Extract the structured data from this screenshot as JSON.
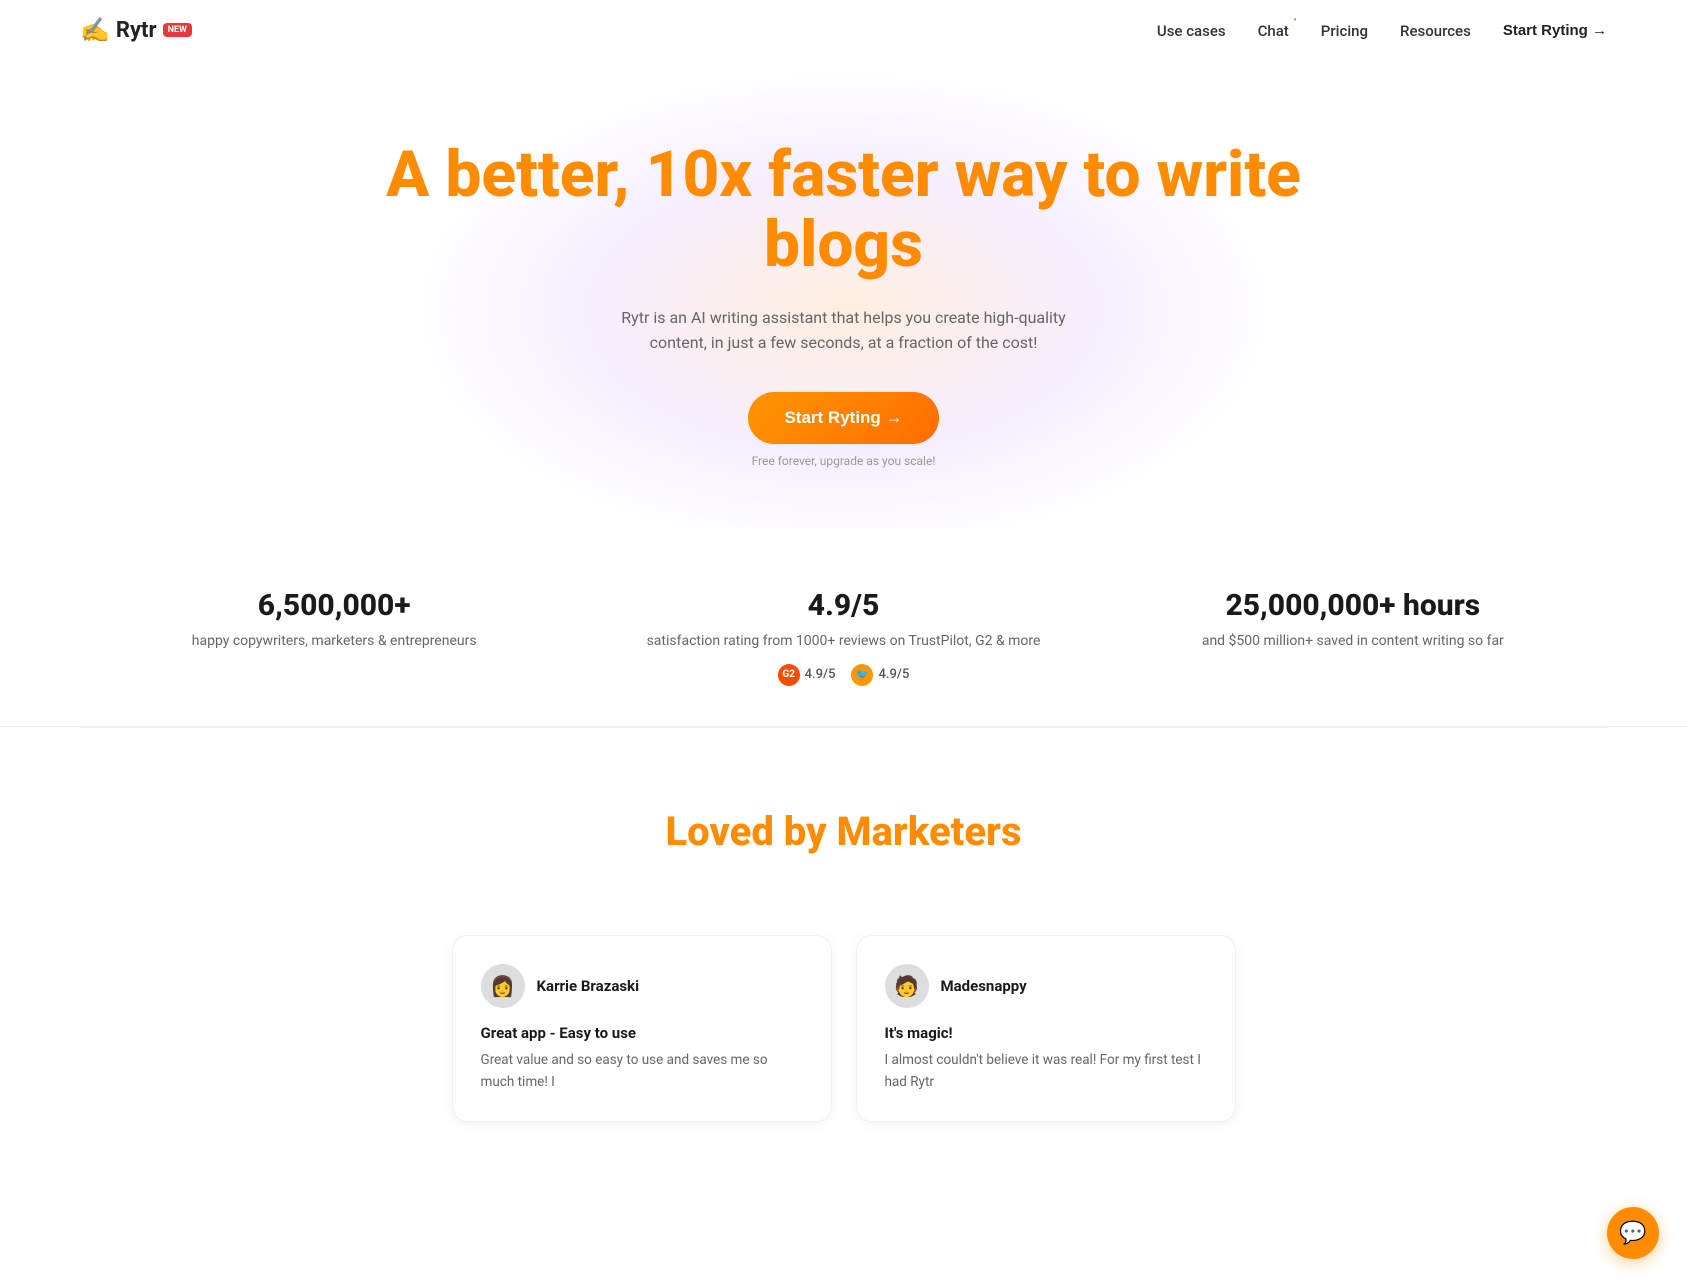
{
  "nav": {
    "logo_text": "Rytr",
    "logo_emoji": "✍️",
    "badge_text": "NEW",
    "links": [
      {
        "label": "Use cases",
        "id": "use-cases"
      },
      {
        "label": "Chat",
        "id": "chat",
        "has_dot": true
      },
      {
        "label": "Pricing",
        "id": "pricing"
      },
      {
        "label": "Resources",
        "id": "resources"
      }
    ],
    "cta_label": "Start Ryting →"
  },
  "hero": {
    "headline_line1": "A better, 10x faster way to write",
    "headline_line2": "blogs",
    "subtitle": "Rytr is an AI writing assistant that helps you create high-quality content, in just a few seconds, at a fraction of the cost!",
    "cta_button": "Start Ryting →",
    "cta_note": "Free forever, upgrade as you scale!"
  },
  "stats": [
    {
      "number": "6,500,000+",
      "description": "happy copywriters, marketers & entrepreneurs",
      "badges": []
    },
    {
      "number": "4.9/5",
      "description": "satisfaction rating from 1000+ reviews on TrustPilot, G2 & more",
      "badges": [
        {
          "icon": "G2",
          "rating": "4.9/5",
          "type": "g2"
        },
        {
          "icon": "🐦",
          "rating": "4.9/5",
          "type": "capterra"
        }
      ]
    },
    {
      "number": "25,000,000+ hours",
      "description": "and $500 million+ saved in content writing so far",
      "badges": []
    }
  ],
  "loved_section": {
    "title_prefix": "Loved by ",
    "title_highlight": "Marketers"
  },
  "testimonials": [
    {
      "avatar_emoji": "👩",
      "name": "Karrie Brazaski",
      "review_title": "Great app - Easy to use",
      "text": "Great value and so easy to use and saves me so much time! I"
    },
    {
      "avatar_emoji": "🧑",
      "name": "Madesnappy",
      "review_title": "It's magic!",
      "text": "I almost couldn't believe it was real! For my first test I had Rytr"
    }
  ],
  "chat_button": {
    "aria_label": "Open chat",
    "icon": "💬"
  }
}
